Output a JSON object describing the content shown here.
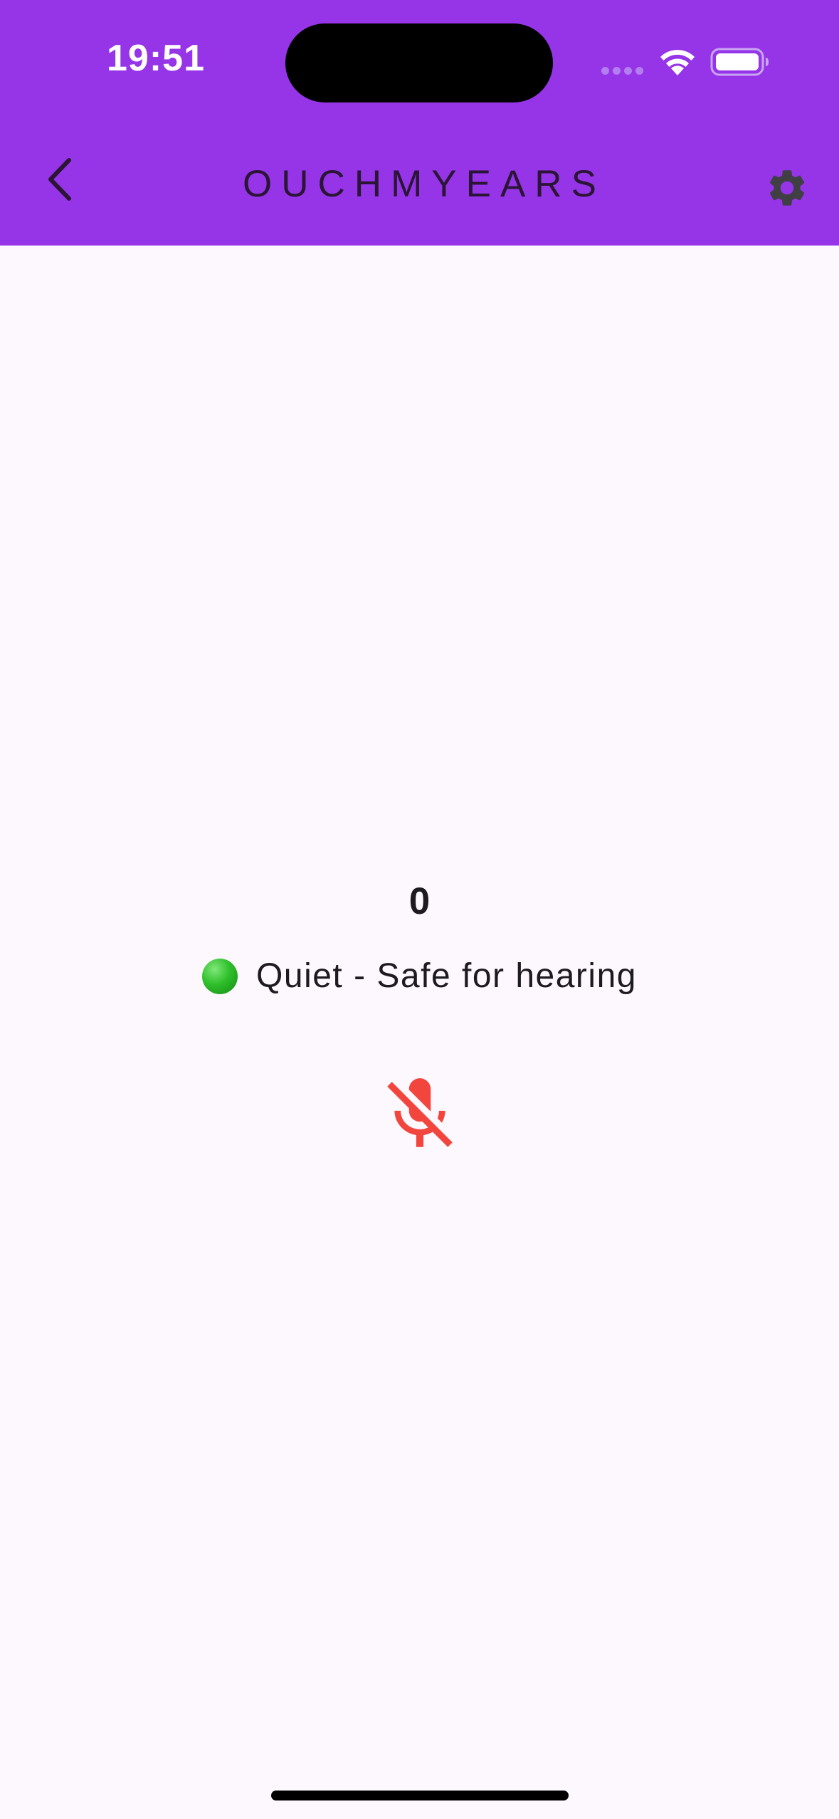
{
  "status_bar": {
    "time": "19:51"
  },
  "header": {
    "title": "OUCHMYEARS",
    "back_icon": "chevron-left-icon",
    "settings_icon": "gear-icon"
  },
  "meter": {
    "value": "0",
    "status_indicator": "green-circle",
    "status_text": "Quiet - Safe for hearing",
    "mic_icon": "mic-off-icon"
  },
  "colors": {
    "app_bar": "#9634e7",
    "background": "#fdf7fe",
    "mic_off": "#f2453d",
    "status_green": "#2fbf2b"
  }
}
